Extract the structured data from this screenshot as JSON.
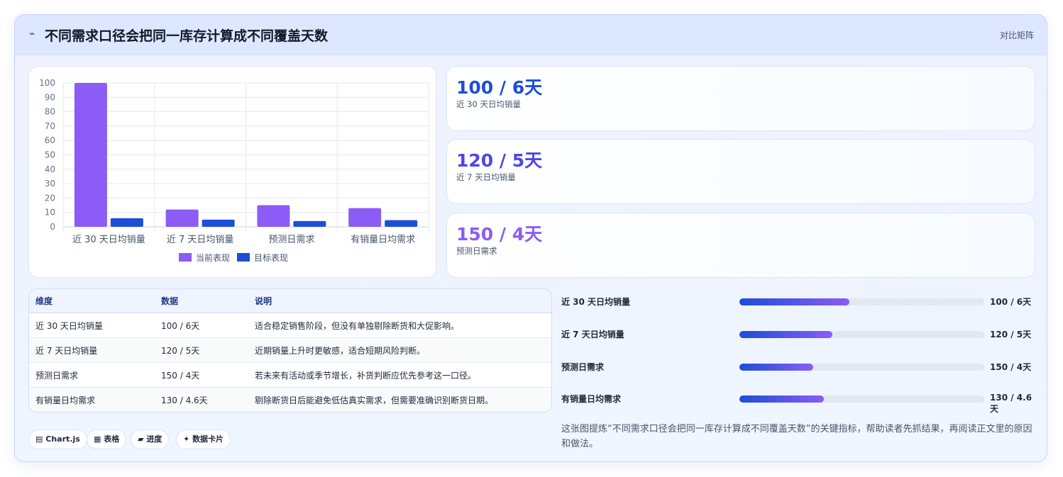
{
  "header": {
    "icon": "chart-line-icon",
    "title": "不同需求口径会把同一库存计算成不同覆盖天数",
    "compare_label": "对比矩阵"
  },
  "chart_data": {
    "type": "bar",
    "categories": [
      "近 30 天日均销量",
      "近 7 天日均销量",
      "预测日需求",
      "有销量日均需求"
    ],
    "series": [
      {
        "name": "当前表现",
        "values": [
          100,
          12,
          15,
          13
        ],
        "color": "#8b5cf6"
      },
      {
        "name": "目标表现",
        "values": [
          6,
          5,
          4,
          4.6
        ],
        "color": "#1d4ed8"
      }
    ],
    "ylim": [
      0,
      100
    ],
    "yticks": [
      "0",
      "10",
      "20",
      "30",
      "40",
      "50",
      "60",
      "70",
      "80",
      "90",
      "100"
    ],
    "grid": true,
    "legend_position": "bottom"
  },
  "kpis": [
    {
      "value": "100 / 6天",
      "label": "近 30 天日均销量",
      "color": "#1d4ed8"
    },
    {
      "value": "120 / 5天",
      "label": "近 7 天日均销量",
      "color": "#4f46e5"
    },
    {
      "value": "150 / 4天",
      "label": "预测日需求",
      "color": "#8b5cf6"
    }
  ],
  "table": {
    "headers": [
      "维度",
      "数据",
      "说明"
    ],
    "rows": [
      [
        "近 30 天日均销量",
        "100 / 6天",
        "适合稳定销售阶段，但没有单独剔除断货和大促影响。"
      ],
      [
        "近 7 天日均销量",
        "120 / 5天",
        "近期销量上升时更敏感，适合短期风险判断。"
      ],
      [
        "预测日需求",
        "150 / 4天",
        "若未来有活动或季节增长，补货判断应优先参考这一口径。"
      ],
      [
        "有销量日均需求",
        "130 / 4.6天",
        "剔除断货日后能避免低估真实需求，但需要准确识别断货日期。"
      ]
    ]
  },
  "progress": [
    {
      "label": "近 30 天日均销量",
      "value": "100 / 6天",
      "fraction": 0.45
    },
    {
      "label": "近 7 天日均销量",
      "value": "120 / 5天",
      "fraction": 0.38
    },
    {
      "label": "预测日需求",
      "value": "150 / 4天",
      "fraction": 0.3
    },
    {
      "label": "有销量日均需求",
      "value": "130 / 4.6天",
      "fraction": 0.345
    }
  ],
  "tags": [
    {
      "icon": "▤",
      "label": "Chart.js"
    },
    {
      "icon": "▦",
      "label": "表格"
    },
    {
      "icon": "▰",
      "label": "进度"
    },
    {
      "icon": "✦",
      "label": "数据卡片"
    }
  ],
  "note": "这张图提炼“不同需求口径会把同一库存计算成不同覆盖天数”的关键指标，帮助读者先抓结果，再阅读正文里的原因和做法。"
}
